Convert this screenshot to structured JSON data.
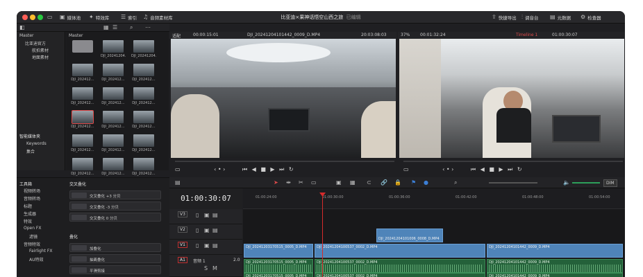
{
  "titlebar": {
    "title": "比亚迪×果神话悟空山西之旅",
    "subtitle": "已编辑",
    "media_pool": "媒体池",
    "effects": "特效库",
    "index": "索引",
    "sound_library": "音频素材库",
    "quick_export": "快捷导出",
    "mixer": "调音台",
    "metadata": "元数据",
    "inspector": "检查器"
  },
  "source_viewer": {
    "zoom": "适配",
    "timecode_left": "00:00:15:01",
    "clip_name": "DJI_20241204101442_0009_D.MP4",
    "timecode_right": "20:03:08:03"
  },
  "timeline_viewer": {
    "zoom": "37%",
    "timecode_left": "00:01:32:24",
    "timeline_name": "Timeline 1",
    "timecode_right": "01:00:30:07"
  },
  "media_pool": {
    "bin_tree": [
      "Master",
      "比亚迪官方",
      "航拍素材",
      "地面素材"
    ],
    "smart_bins_title": "智能媒体夹",
    "smart_bins": [
      "Keywords",
      "集合"
    ],
    "header": "Master",
    "items": [
      "",
      "DJI_20241204…",
      "DJI_20241204…",
      "DJI_202412…",
      "DJI_202412…",
      "DJI_202412…",
      "DJI_202412…",
      "DJI_202412…",
      "DJI_202412…",
      "DJI_202412…",
      "DJI_202412…",
      "DJI_202412…",
      "DJI_202412…",
      "DJI_202412…",
      "DJI_202412…",
      "DJI_202412…",
      "DJI_202412…",
      "DJI_202412…"
    ]
  },
  "effects": {
    "tree_title": "工具箱",
    "tree": [
      "视频转场",
      "音频转场",
      "标题",
      "生成器",
      "特效",
      "Open FX",
      "滤镜",
      "音频特效",
      "Fairlight FX",
      "AU特效"
    ],
    "section1": "交叉叠化",
    "section1_items": [
      "交叉叠化 +3 分贝",
      "交叉叠化 -3 分贝",
      "交叉叠化 0 分贝"
    ],
    "section2": "叠化",
    "section2_items": [
      "加叠化",
      "抽离叠化",
      "平滑剪接"
    ]
  },
  "timeline": {
    "timecode": "01:00:30:07",
    "ruler": [
      "01:00:24:00",
      "01:00:30:00",
      "01:00:36:00",
      "01:00:42:00",
      "01:00:48:00",
      "01:00:54:00"
    ],
    "tracks": [
      "V3",
      "V2",
      "V1",
      "A1"
    ],
    "a1_name": "音频 1",
    "a1_level": "2.0",
    "dim_label": "DIM",
    "v2_clip": "DJI_20241204101006_0008_D.MP4",
    "v1_clips": [
      "DJI_20241203170515_0005_D.MP4",
      "DJI_20241204100537_0002_D.MP4",
      "DJI_20241204101442_0009_D.MP4"
    ],
    "a1_clips": [
      "DJI_20241203170515_0005_D.MP4",
      "DJI_20241204100537_0002_D.MP4",
      "DJI_20241204101442_0009_D.MP4"
    ]
  }
}
